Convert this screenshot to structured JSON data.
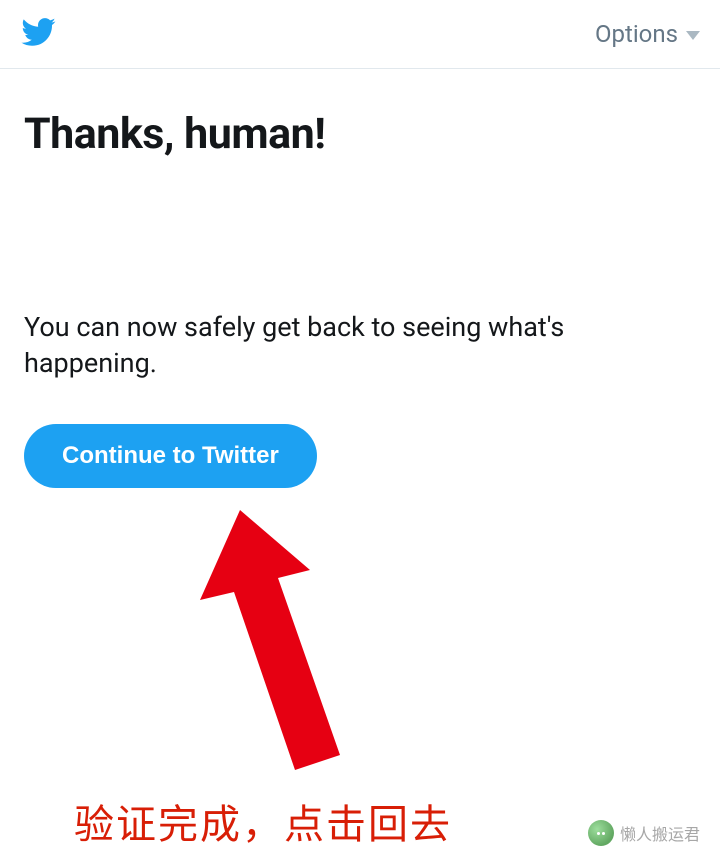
{
  "header": {
    "options_label": "Options"
  },
  "main": {
    "heading": "Thanks, human!",
    "subtext": "You can now safely get back to seeing what's happening.",
    "continue_label": "Continue to Twitter"
  },
  "annotation": {
    "caption": "验证完成，点击回去",
    "watermark_text": "懒人搬运君"
  },
  "colors": {
    "twitter_blue": "#1da1f2",
    "annotation_red": "#d81e06",
    "text_dark": "#14171a",
    "text_muted": "#657786"
  }
}
